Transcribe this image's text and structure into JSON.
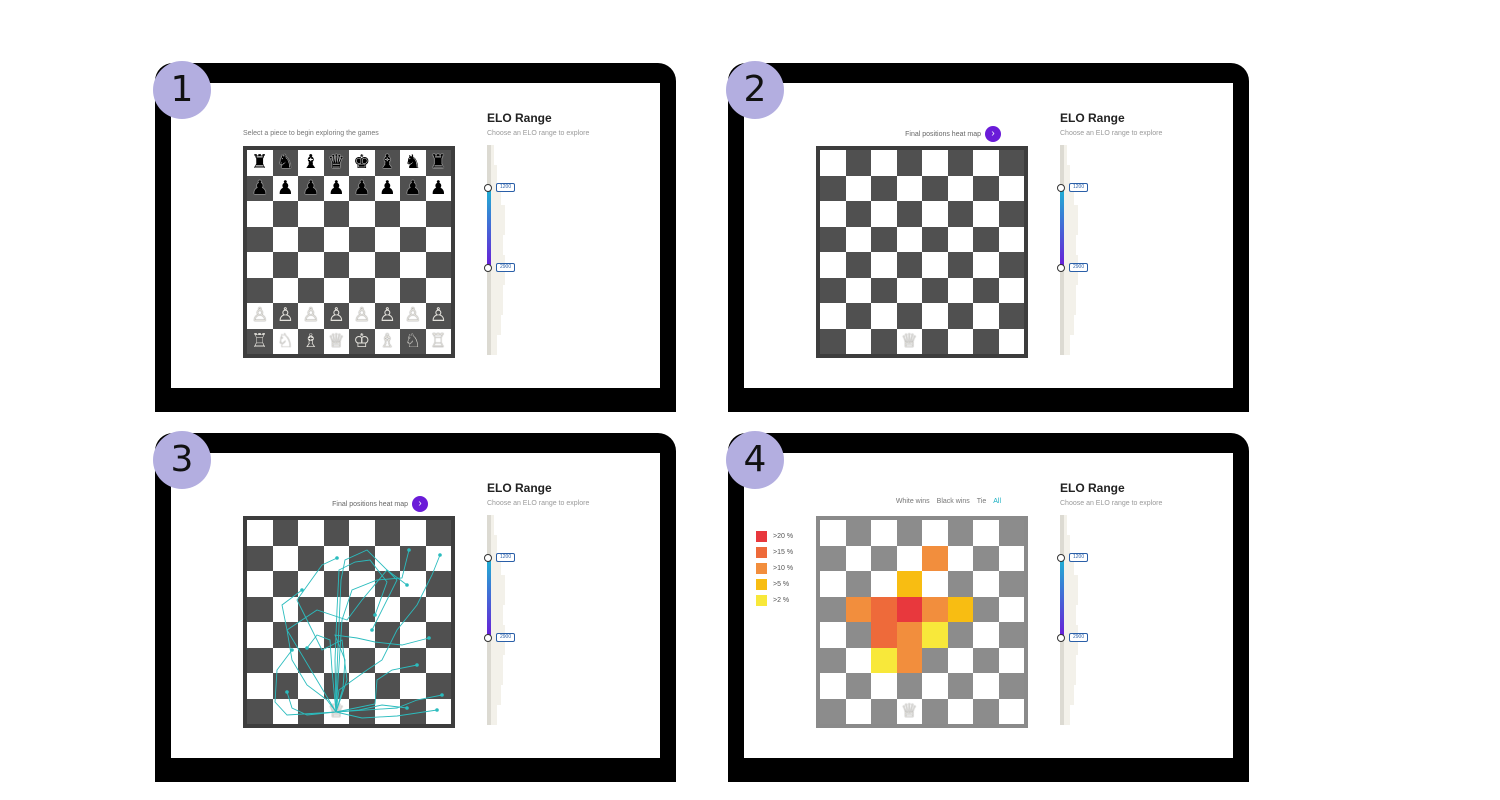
{
  "panels": [
    {
      "number": "1",
      "elo_title": "ELO Range",
      "elo_subtitle": "Choose an ELO range to explore",
      "hint": "Select a piece to begin exploring the games",
      "slider_low": "1200",
      "slider_high": "2900"
    },
    {
      "number": "2",
      "elo_title": "ELO Range",
      "elo_subtitle": "Choose an ELO range to explore",
      "heatmap_link": "Final positions heat map",
      "slider_low": "1200",
      "slider_high": "2900"
    },
    {
      "number": "3",
      "elo_title": "ELO Range",
      "elo_subtitle": "Choose an ELO range to explore",
      "heatmap_link": "Final positions heat map",
      "slider_low": "1200",
      "slider_high": "2900"
    },
    {
      "number": "4",
      "elo_title": "ELO Range",
      "elo_subtitle": "Choose an ELO range to explore",
      "filters": [
        "White wins",
        "Black wins",
        "Tie",
        "All"
      ],
      "active_filter": "All",
      "slider_low": "1200",
      "slider_high": "2900"
    }
  ],
  "pieces": {
    "black_back": [
      "♜",
      "♞",
      "♝",
      "♛",
      "♚",
      "♝",
      "♞",
      "♜"
    ],
    "black_pawn": "♟",
    "white_pawn": "♙",
    "white_back": [
      "♖",
      "♘",
      "♗",
      "♕",
      "♔",
      "♗",
      "♘",
      "♖"
    ],
    "queen": "♕"
  },
  "heat_legend": [
    {
      "label": ">20 %",
      "color": "#e8383d"
    },
    {
      "label": ">15 %",
      "color": "#ee6a3a"
    },
    {
      "label": ">10 %",
      "color": "#f28e3d"
    },
    {
      "label": ">5 %",
      "color": "#f8bd12"
    },
    {
      "label": ">2 %",
      "color": "#f8e83a"
    }
  ],
  "colors": {
    "badge": "#b3aee0",
    "accent_purple": "#6a1bd8",
    "accent_teal": "#1eb3d3",
    "trajectory": "#2bbcbe"
  }
}
